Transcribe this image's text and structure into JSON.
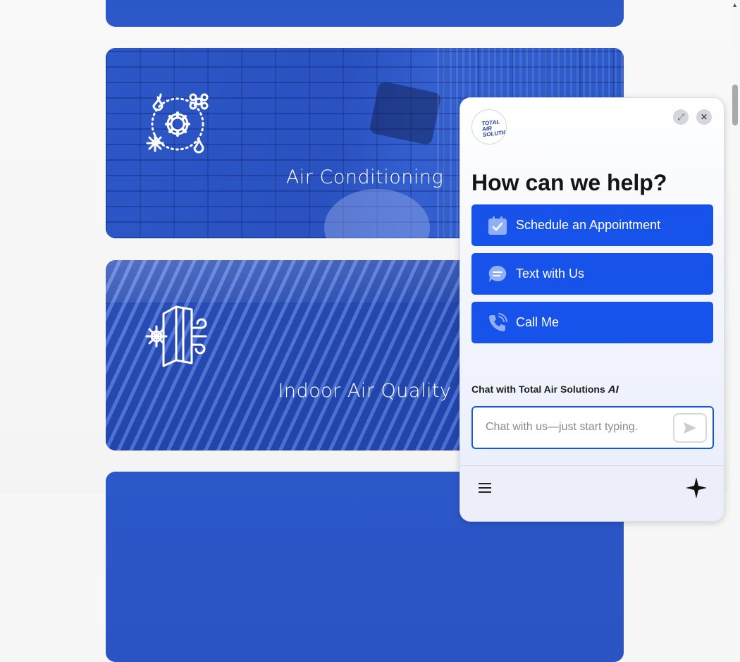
{
  "services": [
    {
      "title": ""
    },
    {
      "title": "Air Conditioning",
      "icon": "ac-gear-snowflake-icon"
    },
    {
      "title": "Indoor Air Quality",
      "icon": "air-filter-icon"
    },
    {
      "title": ""
    }
  ],
  "widget": {
    "logo_text": "TOTAL AIR SOLUTIONS",
    "heading": "How can we help?",
    "actions": [
      {
        "label": "Schedule an Appointment",
        "icon": "calendar-check-icon"
      },
      {
        "label": "Text with Us",
        "icon": "chat-bubble-icon"
      },
      {
        "label": "Call Me",
        "icon": "phone-icon"
      }
    ],
    "chat_label": "Chat with Total Air Solutions",
    "ai_badge": "AI",
    "chat_placeholder": "Chat with us—just start typing."
  },
  "colors": {
    "accent": "#1753ea",
    "card_overlay": "#2653c9"
  }
}
